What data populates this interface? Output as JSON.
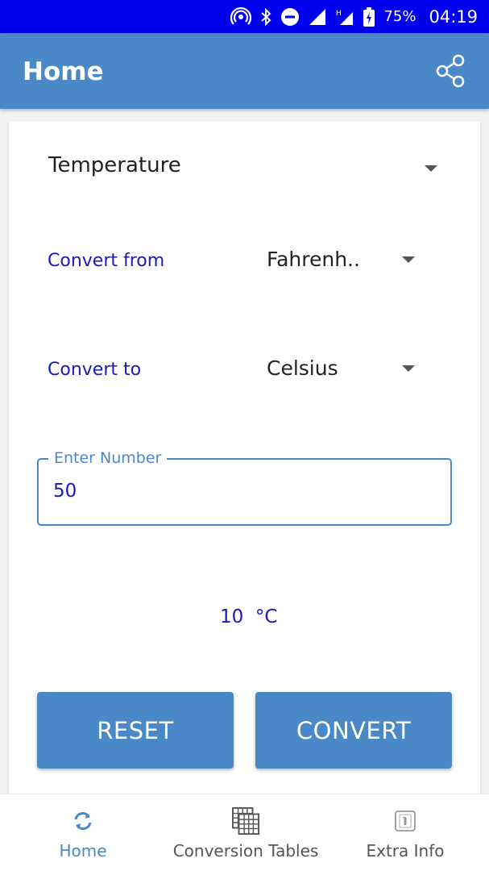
{
  "status_bar": {
    "battery": "75%",
    "time": "04:19",
    "icons": [
      "hotspot-icon",
      "bluetooth-icon",
      "do-not-disturb-icon",
      "signal-icon",
      "signal-h-icon",
      "battery-charging-icon"
    ]
  },
  "app_bar": {
    "title": "Home",
    "share_icon": "share-icon"
  },
  "form": {
    "category": "Temperature",
    "convert_from_label": "Convert from",
    "convert_from_value": "Fahrenh..",
    "convert_to_label": "Convert to",
    "convert_to_value": "Celsius",
    "number_label": "Enter Number",
    "number_value": "50",
    "result": "10  °C",
    "reset_label": "RESET",
    "convert_label": "CONVERT"
  },
  "bottom_nav": {
    "items": [
      {
        "label": "Home",
        "icon": "refresh-icon",
        "active": true
      },
      {
        "label": "Conversion Tables",
        "icon": "table-icon",
        "active": false
      },
      {
        "label": "Extra Info",
        "icon": "info-icon",
        "active": false
      }
    ]
  },
  "colors": {
    "status_bar": "#0000ee",
    "primary": "#4a89c8",
    "label_text": "#1a1ab8"
  }
}
